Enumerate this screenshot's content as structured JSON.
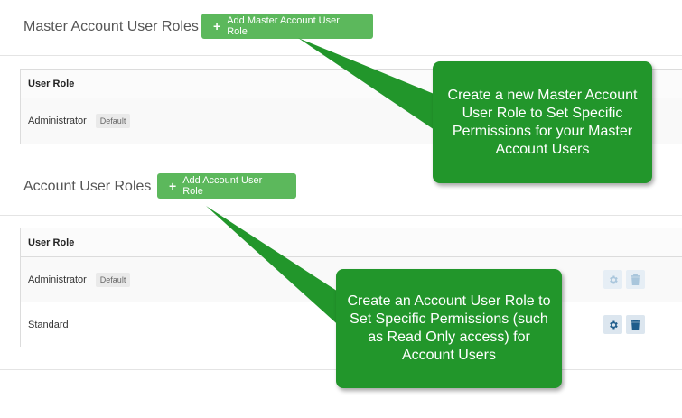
{
  "master_section": {
    "title": "Master Account User Roles",
    "add_button": "Add Master Account User Role",
    "table": {
      "header": "User Role",
      "rows": [
        {
          "name": "Administrator",
          "badge": "Default"
        }
      ]
    }
  },
  "account_section": {
    "title": "Account User Roles",
    "add_button": "Add Account User Role",
    "table": {
      "header": "User Role",
      "rows": [
        {
          "name": "Administrator",
          "badge": "Default",
          "actions_enabled": false
        },
        {
          "name": "Standard",
          "actions_enabled": true
        }
      ]
    }
  },
  "callouts": {
    "master": "Create a new Master Account User Role to Set Specific Permissions for your Master Account Users",
    "account": "Create an Account User Role to Set Specific Permissions (such as Read Only access) for Account Users"
  },
  "colors": {
    "button_green": "#5cb85c",
    "callout_green": "#22962b",
    "action_icon_active": "#1f5d8c",
    "action_icon_disabled": "#a9c6dc"
  },
  "icons": {
    "plus": "plus-icon",
    "gear": "gear-icon",
    "trash": "trash-icon"
  }
}
